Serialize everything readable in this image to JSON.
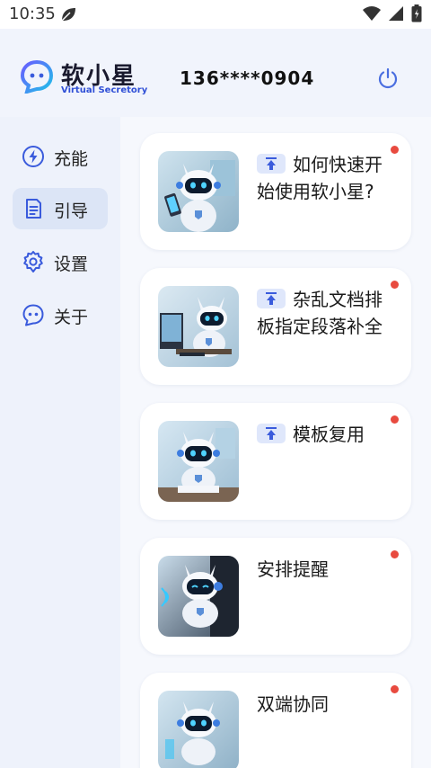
{
  "status_bar": {
    "time": "10:35",
    "icons": [
      "leaf-icon",
      "wifi-icon",
      "signal-icon",
      "battery-icon"
    ]
  },
  "header": {
    "logo_title": "软小星",
    "logo_subtitle": "Virtual Secretory",
    "phone": "136****0904",
    "power_icon": "power-icon"
  },
  "sidebar": {
    "items": [
      {
        "label": "充能",
        "icon": "lightning-icon",
        "active": false
      },
      {
        "label": "引导",
        "icon": "document-icon",
        "active": true
      },
      {
        "label": "设置",
        "icon": "gear-icon",
        "active": false
      },
      {
        "label": "关于",
        "icon": "chat-bot-icon",
        "active": false
      }
    ]
  },
  "cards": [
    {
      "title": "如何快速开始使用软小星?",
      "pinned": true,
      "unread": true
    },
    {
      "title": "杂乱文档排板指定段落补全",
      "pinned": true,
      "unread": true
    },
    {
      "title": "模板复用",
      "pinned": true,
      "unread": true
    },
    {
      "title": "安排提醒",
      "pinned": false,
      "unread": true
    },
    {
      "title": "双端协同",
      "pinned": false,
      "unread": true
    }
  ],
  "colors": {
    "accent": "#3a5bdc",
    "active_bg": "#dce5f6",
    "unread_dot": "#e84a3f"
  }
}
